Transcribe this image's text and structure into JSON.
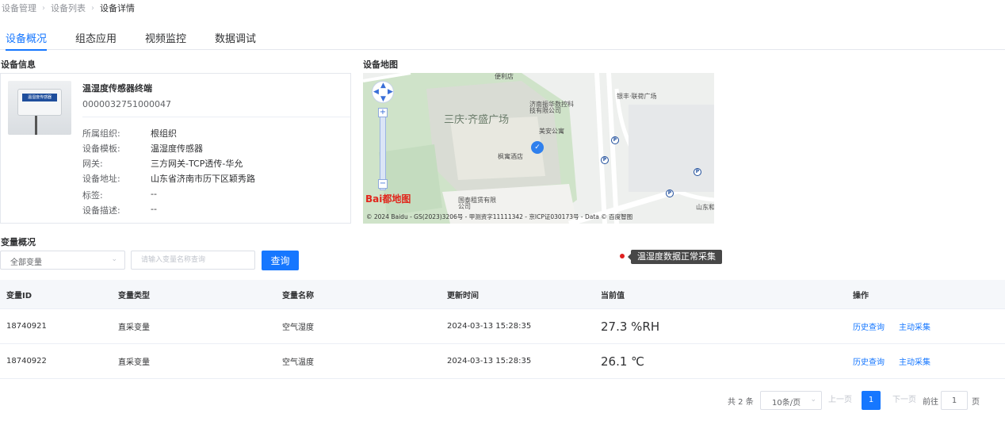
{
  "breadcrumb": [
    "设备管理",
    "设备列表",
    "设备详情"
  ],
  "tabs": [
    {
      "label": "设备概况",
      "active": true
    },
    {
      "label": "组态应用",
      "active": false
    },
    {
      "label": "视频监控",
      "active": false
    },
    {
      "label": "数据调试",
      "active": false
    }
  ],
  "device_info": {
    "title": "设备信息",
    "image_label": "温湿度传感器",
    "name": "温湿度传感器终端",
    "code": "0000032751000047",
    "fields": [
      {
        "key": "所属组织:",
        "value": "根组织"
      },
      {
        "key": "设备模板:",
        "value": "温湿度传感器"
      },
      {
        "key": "网关:",
        "value": "三方网关-TCP透传-华允"
      },
      {
        "key": "设备地址:",
        "value": "山东省济南市历下区颖秀路"
      },
      {
        "key": "标签:",
        "value": "--"
      },
      {
        "key": "设备描述:",
        "value": "--"
      }
    ]
  },
  "device_map": {
    "title": "设备地图",
    "labels": {
      "plaza": "三庆·齐盛广场",
      "shop": "便利店",
      "company1": "济南振华数控科技有限公司",
      "apartment": "美安公寓",
      "hotel": "枫寓酒店",
      "yinfeng": "银丰·联荷广场",
      "guotai": "国泰租赁有限公司",
      "shandong": "山东和"
    },
    "logo": "Bai都地图",
    "copyright": "© 2024 Baidu - GS(2023)3206号 - 甲测资字11111342 - 京ICP证030173号 - Data © 百度智图"
  },
  "variables": {
    "title": "变量概况",
    "filter_select": "全部变量",
    "search_placeholder": "请输入变量名称查询",
    "query_button": "查询",
    "tooltip": "温湿度数据正常采集",
    "columns": [
      "变量ID",
      "变量类型",
      "变量名称",
      "更新时间",
      "当前值",
      "操作"
    ],
    "rows": [
      {
        "id": "18740921",
        "type": "直采变量",
        "name": "空气湿度",
        "time": "2024-03-13 15:28:35",
        "value": "27.3 %RH",
        "ops": [
          "历史查询",
          "主动采集"
        ]
      },
      {
        "id": "18740922",
        "type": "直采变量",
        "name": "空气温度",
        "time": "2024-03-13 15:28:35",
        "value": "26.1 ℃",
        "ops": [
          "历史查询",
          "主动采集"
        ]
      }
    ]
  },
  "pagination": {
    "total": "共 2 条",
    "page_size": "10条/页",
    "prev": "上一页",
    "current": "1",
    "next": "下一页",
    "goto_label": "前往",
    "goto_value": "1",
    "goto_suffix": "页"
  },
  "colors": {
    "accent": "#1677ff",
    "tooltip_bg": "#474747",
    "status_dot": "#e02020"
  }
}
